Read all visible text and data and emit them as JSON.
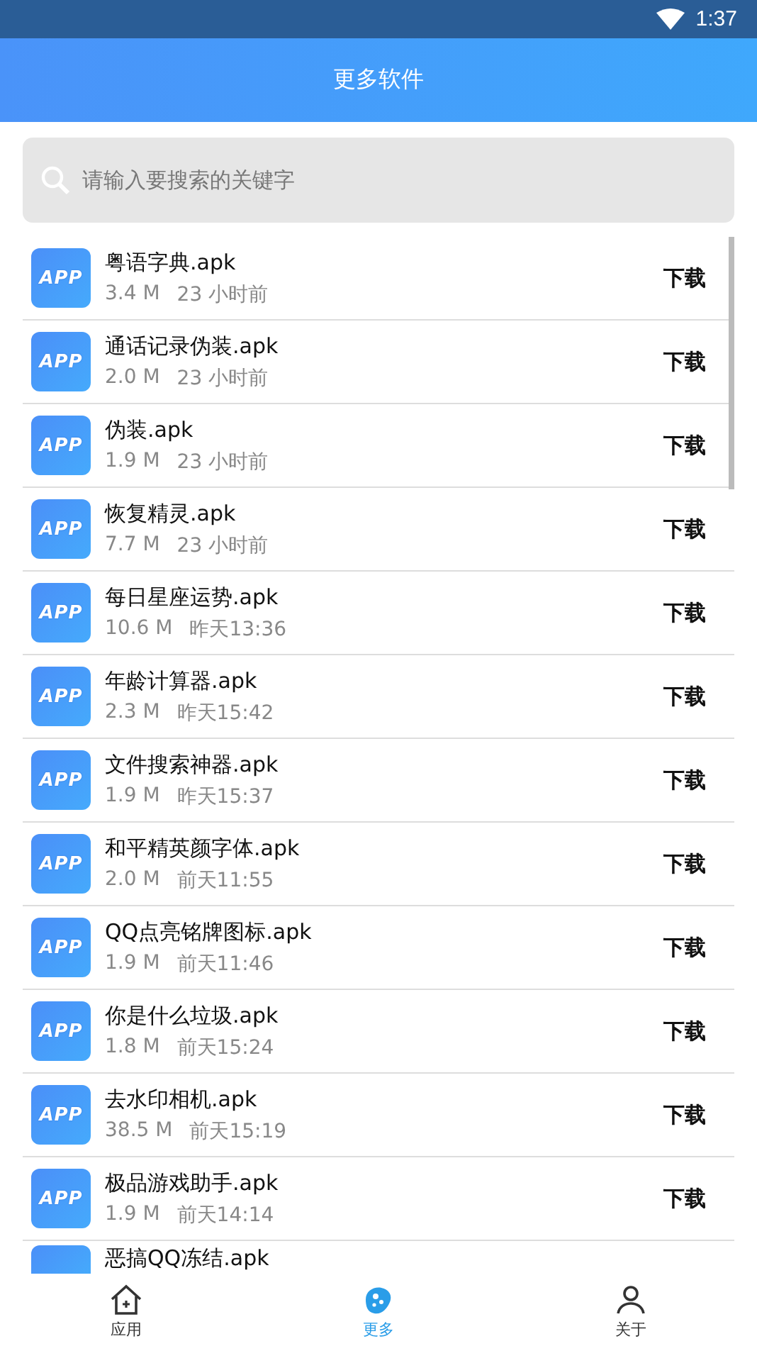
{
  "status_bar": {
    "time": "1:37"
  },
  "header": {
    "title": "更多软件"
  },
  "search": {
    "placeholder": "请输入要搜索的关键字"
  },
  "apps": [
    {
      "icon_label": "APP",
      "name": "粤语字典.apk",
      "size": "3.4 M",
      "time": "23 小时前",
      "action": "下载"
    },
    {
      "icon_label": "APP",
      "name": "通话记录伪装.apk",
      "size": "2.0 M",
      "time": "23 小时前",
      "action": "下载"
    },
    {
      "icon_label": "APP",
      "name": "伪装.apk",
      "size": "1.9 M",
      "time": "23 小时前",
      "action": "下载"
    },
    {
      "icon_label": "APP",
      "name": "恢复精灵.apk",
      "size": "7.7 M",
      "time": "23 小时前",
      "action": "下载"
    },
    {
      "icon_label": "APP",
      "name": "每日星座运势.apk",
      "size": "10.6 M",
      "time": "昨天13:36",
      "action": "下载"
    },
    {
      "icon_label": "APP",
      "name": "年龄计算器.apk",
      "size": "2.3 M",
      "time": "昨天15:42",
      "action": "下载"
    },
    {
      "icon_label": "APP",
      "name": "文件搜索神器.apk",
      "size": "1.9 M",
      "time": "昨天15:37",
      "action": "下载"
    },
    {
      "icon_label": "APP",
      "name": "和平精英颜字体.apk",
      "size": "2.0 M",
      "time": "前天11:55",
      "action": "下载"
    },
    {
      "icon_label": "APP",
      "name": "QQ点亮铭牌图标.apk",
      "size": "1.9 M",
      "time": "前天11:46",
      "action": "下载"
    },
    {
      "icon_label": "APP",
      "name": "你是什么垃圾.apk",
      "size": "1.8 M",
      "time": "前天15:24",
      "action": "下载"
    },
    {
      "icon_label": "APP",
      "name": "去水印相机.apk",
      "size": "38.5 M",
      "time": "前天15:19",
      "action": "下载"
    },
    {
      "icon_label": "APP",
      "name": "极品游戏助手.apk",
      "size": "1.9 M",
      "time": "前天14:14",
      "action": "下载"
    },
    {
      "kind": "partial",
      "name": "恶搞QQ冻结.apk"
    }
  ],
  "nav": [
    {
      "kind": "home",
      "label": "应用",
      "selected": false
    },
    {
      "kind": "more",
      "label": "更多",
      "selected": true
    },
    {
      "kind": "about",
      "label": "关于",
      "selected": false
    }
  ]
}
